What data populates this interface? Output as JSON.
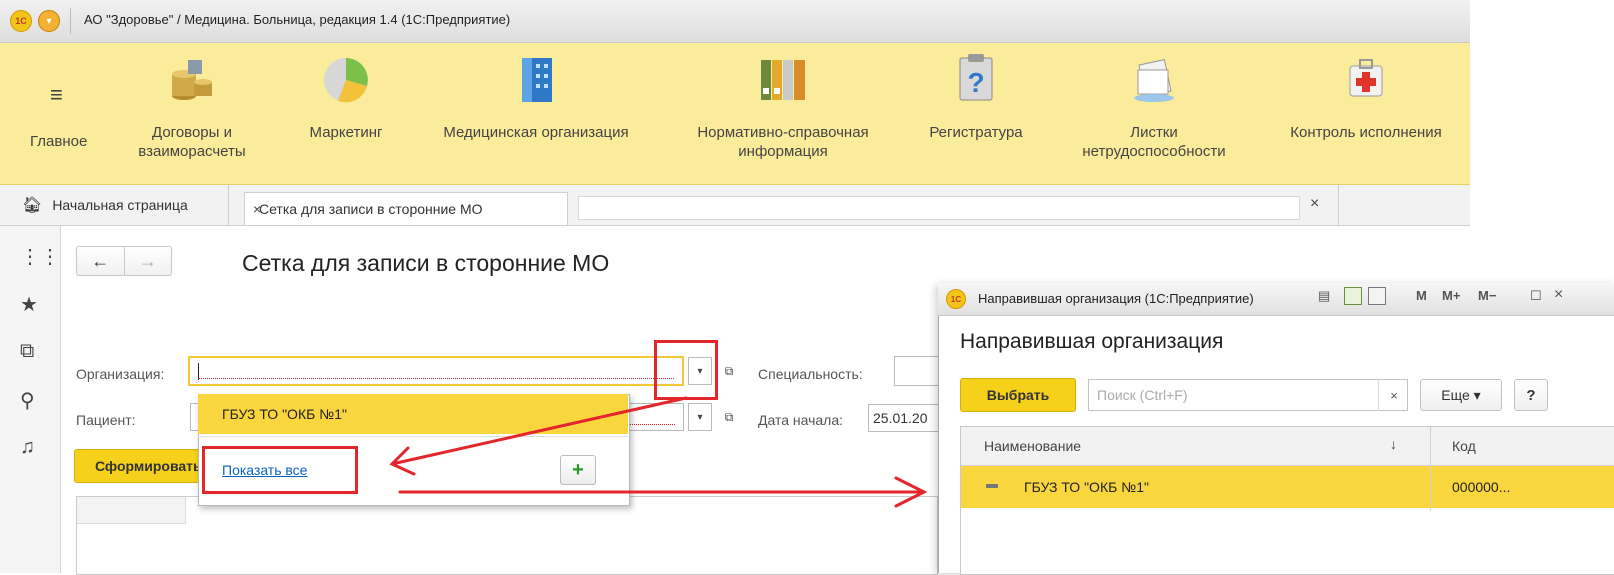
{
  "app": {
    "title": "АО \"Здоровье\" / Медицина. Больница, редакция 1.4  (1С:Предприятие)",
    "logo_text": "1С"
  },
  "sections": [
    {
      "label": "Главное",
      "icon": "menu-icon"
    },
    {
      "label": "Договоры и взаиморасчеты",
      "icon": "coins-icon"
    },
    {
      "label": "Маркетинг",
      "icon": "pie-chart-icon"
    },
    {
      "label": "Медицинская организация",
      "icon": "building-icon"
    },
    {
      "label": "Нормативно-справочная информация",
      "icon": "binders-icon"
    },
    {
      "label": "Регистратура",
      "icon": "clipboard-question-icon"
    },
    {
      "label": "Листки нетрудоспособности",
      "icon": "documents-icon"
    },
    {
      "label": "Контроль исполнения",
      "icon": "first-aid-icon"
    }
  ],
  "tabs": {
    "home": "Начальная страница",
    "active": "Сетка для записи в сторонние МО",
    "close_glyph": "×"
  },
  "form": {
    "title": "Сетка для записи в сторонние МО",
    "org_label": "Организация:",
    "patient_label": "Пациент:",
    "specialty_label": "Специальность:",
    "start_date_label": "Дата начала:",
    "start_date_value": "25.01.20",
    "generate_button": "Сформировать"
  },
  "dropdown": {
    "item": "ГБУЗ ТО \"ОКБ №1\"",
    "show_all": "Показать все",
    "add_glyph": "+"
  },
  "child_window": {
    "title": "Направившая организация  (1С:Предприятие)",
    "heading": "Направившая организация",
    "select_button": "Выбрать",
    "search_placeholder": "Поиск (Ctrl+F)",
    "search_clear": "×",
    "more_button": "Еще ▾",
    "help_button": "?",
    "tools": {
      "m": "M",
      "mplus": "M+",
      "mminus": "M−",
      "max": "☐",
      "close": "×"
    },
    "columns": {
      "name": "Наименование",
      "sort_glyph": "↓",
      "code": "Код"
    },
    "rows": [
      {
        "name": "ГБУЗ ТО \"ОКБ №1\"",
        "code": "000000..."
      }
    ]
  },
  "colors": {
    "section_bar": "#fbec9c",
    "accent_yellow": "#f5d11c",
    "selected_row": "#f9d63e",
    "annotation_red": "#e3262c",
    "link_blue": "#0a62c3"
  }
}
